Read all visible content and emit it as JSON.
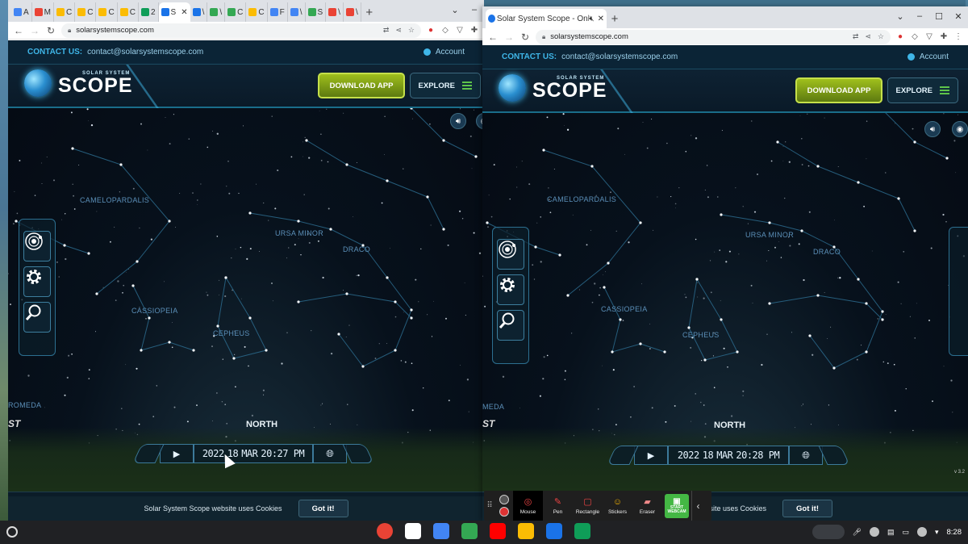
{
  "left_window": {
    "tabs": [
      {
        "label": "A",
        "color": "#4285f4"
      },
      {
        "label": "M",
        "color": "#ea4335"
      },
      {
        "label": "C",
        "color": "#fbbc04"
      },
      {
        "label": "C",
        "color": "#fbbc04"
      },
      {
        "label": "C",
        "color": "#fbbc04"
      },
      {
        "label": "C",
        "color": "#fbbc04"
      },
      {
        "label": "2",
        "color": "#0f9d58"
      },
      {
        "label": "S",
        "color": "#1a73e8"
      },
      {
        "label": "\\",
        "color": "#1a73e8"
      },
      {
        "label": "\\",
        "color": "#34a853"
      },
      {
        "label": "C",
        "color": "#34a853"
      },
      {
        "label": "C",
        "color": "#fbbc04"
      },
      {
        "label": "F",
        "color": "#4285f4"
      },
      {
        "label": "\\",
        "color": "#4285f4"
      },
      {
        "label": "S",
        "color": "#34a853"
      },
      {
        "label": "\\",
        "color": "#ea4335"
      },
      {
        "label": "\\",
        "color": "#ea4335"
      }
    ],
    "active_tab_index": 7,
    "active_tab_close": "✕",
    "url": "solarsystemscope.com",
    "time": {
      "year": "2022",
      "day": "18",
      "month": "MAR",
      "clock": "20:27 PM"
    }
  },
  "right_window": {
    "tab_title": "Solar System Scope - Online",
    "url": "solarsystemscope.com",
    "time": {
      "year": "2022",
      "day": "18",
      "month": "MAR",
      "clock": "20:28 PM"
    },
    "version": "v 3.2"
  },
  "site": {
    "contact_label": "CONTACT US:",
    "contact_email": "contact@solarsystemscope.com",
    "account": "Account",
    "logo_sub": "SOLAR SYSTEM",
    "logo_main": "SCOPE",
    "download": "DOWNLOAD APP",
    "explore": "EXPLORE",
    "north": "NORTH",
    "cookie_text": "Solar System Scope website uses Cookies",
    "cookie_text_right": "site uses Cookies",
    "got_it": "Got it!",
    "edge_left": "ST",
    "edge_left2": "ROMEDA",
    "edge_right2": "MEDA",
    "constellations": [
      "CAMELOPARDALIS",
      "URSA MINOR",
      "DRACO",
      "CASSIOPEIA",
      "CEPHEUS"
    ]
  },
  "screencast": {
    "tools": [
      "Mouse",
      "Pen",
      "Rectangle",
      "Stickers",
      "Eraser"
    ],
    "webcam": "START WEBCAM"
  },
  "shelf": {
    "apps": [
      {
        "name": "chrome",
        "color": "#ea4335"
      },
      {
        "name": "gmail",
        "color": "#ffffff"
      },
      {
        "name": "docs",
        "color": "#4285f4"
      },
      {
        "name": "play-store",
        "color": "#34a853"
      },
      {
        "name": "youtube",
        "color": "#ff0000"
      },
      {
        "name": "drive",
        "color": "#fbbc04"
      },
      {
        "name": "files",
        "color": "#1a73e8"
      },
      {
        "name": "sheets-add",
        "color": "#0f9d58"
      }
    ],
    "time": "8:28"
  }
}
